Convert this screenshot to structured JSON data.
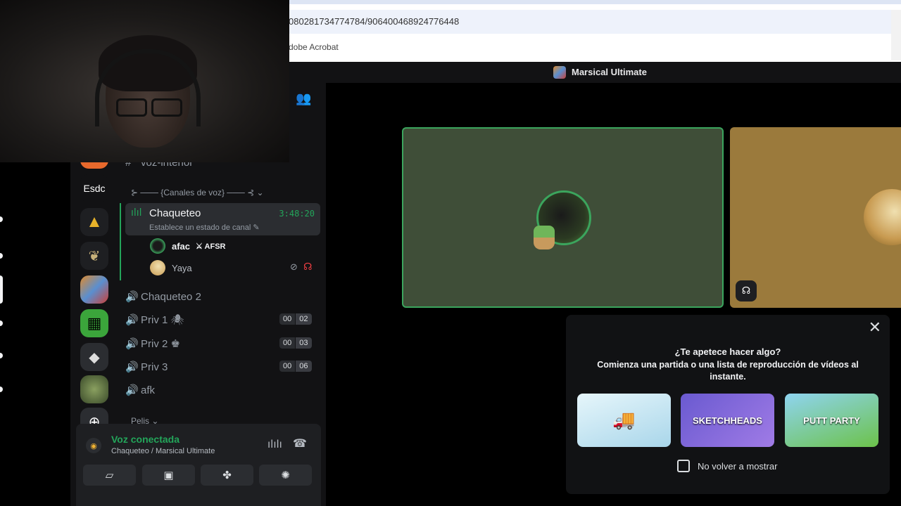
{
  "browser": {
    "url": "080281734774784/906400468924776448",
    "bookmark": "dobe Acrobat"
  },
  "window": {
    "title": "Marsical Ultimate"
  },
  "server_rail": {
    "esdc_label": "Esdc"
  },
  "channels": {
    "partial_text_channel": "voz-interior",
    "voice_category": "⊱ ─── {Canales de voz} ─── ⊰",
    "active": {
      "name": "Chaqueteo",
      "status": "Establece un estado de canal",
      "timer": "3:48:20"
    },
    "members": [
      {
        "name": "afac",
        "tag": "AFSR"
      },
      {
        "name": "Yaya"
      }
    ],
    "others": [
      {
        "name": "Chaqueteo 2"
      },
      {
        "name": "Priv 1 🕷",
        "c1": "00",
        "c2": "02"
      },
      {
        "name": "Priv 2 ♚",
        "c1": "00",
        "c2": "03"
      },
      {
        "name": "Priv 3",
        "c1": "00",
        "c2": "06"
      },
      {
        "name": "afk"
      }
    ],
    "pelis_category": "Pelis"
  },
  "voice_panel": {
    "title": "Voz conectada",
    "subtitle": "Chaqueteo / Marsical Ultimate"
  },
  "activity_popup": {
    "question": "¿Te apetece hacer algo?",
    "description": "Comienza una partida o una lista de reproducción de vídeos al instante.",
    "games": [
      {
        "label": "",
        "color": "#bfe3f0"
      },
      {
        "label": "SKETCHHEADS",
        "color": "#7a66d8"
      },
      {
        "label": "PUTT PARTY",
        "color": "#6cc24a"
      }
    ],
    "checkbox_label": "No volver a mostrar"
  },
  "colors": {
    "accent_green": "#23a55a",
    "background": "#121214",
    "panel": "#1e1f22"
  }
}
